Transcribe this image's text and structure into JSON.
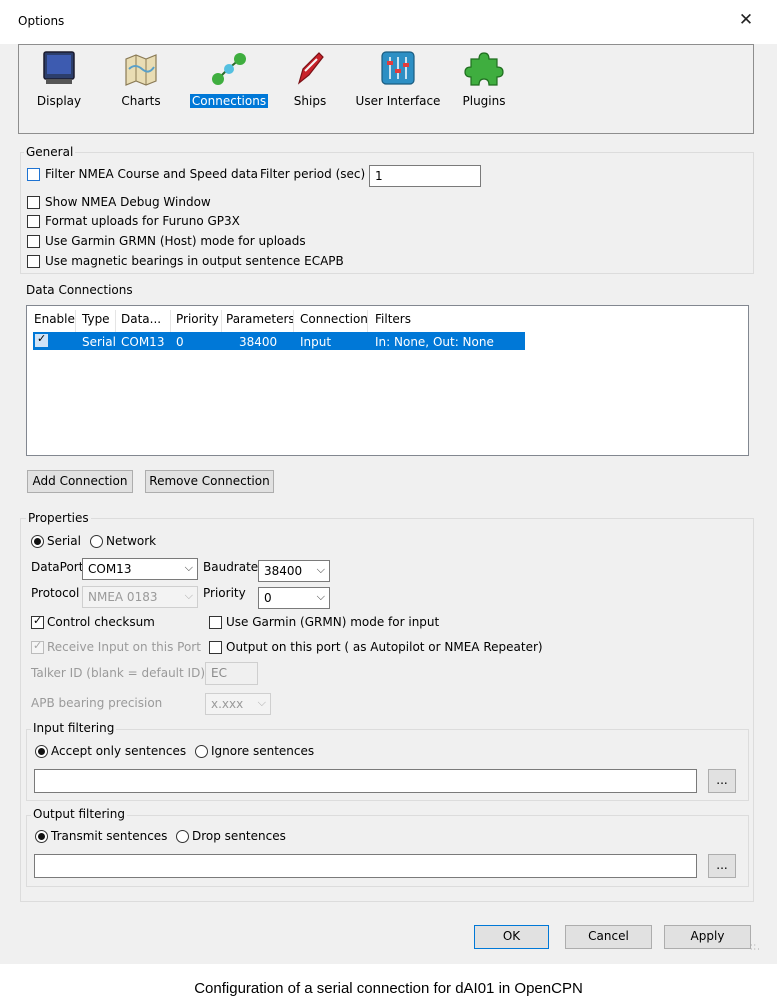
{
  "window": {
    "title": "Options"
  },
  "toolbar": {
    "items": [
      {
        "label": "Display",
        "icon": "monitor-icon"
      },
      {
        "label": "Charts",
        "icon": "chart-map-icon"
      },
      {
        "label": "Connections",
        "icon": "connections-icon",
        "selected": true
      },
      {
        "label": "Ships",
        "icon": "ship-icon"
      },
      {
        "label": "User Interface",
        "icon": "sliders-icon"
      },
      {
        "label": "Plugins",
        "icon": "puzzle-icon"
      }
    ]
  },
  "general": {
    "title": "General",
    "filter_nmea": "Filter NMEA Course and Speed data",
    "filter_period_label": "Filter period (sec)",
    "filter_period_value": "1",
    "show_debug": "Show NMEA Debug Window",
    "furuno": "Format uploads for Furuno GP3X",
    "garmin_host": "Use Garmin GRMN (Host) mode for uploads",
    "magnetic": "Use magnetic bearings in output sentence ECAPB"
  },
  "data_connections": {
    "title": "Data Connections",
    "columns": [
      "Enable",
      "Type",
      "Data...",
      "Priority",
      "Parameters",
      "Connection",
      "Filters"
    ],
    "rows": [
      {
        "enabled": true,
        "type": "Serial",
        "data": "COM13",
        "priority": "0",
        "parameters": "38400",
        "connection": "Input",
        "filters": "In: None, Out: None"
      }
    ],
    "add_button": "Add Connection",
    "remove_button": "Remove Connection"
  },
  "properties": {
    "title": "Properties",
    "serial": "Serial",
    "network": "Network",
    "dataport_label": "DataPort",
    "dataport_value": "COM13",
    "baudrate_label": "Baudrate",
    "baudrate_value": "38400",
    "protocol_label": "Protocol",
    "protocol_value": "NMEA 0183",
    "priority_label": "Priority",
    "priority_value": "0",
    "control_checksum": "Control checksum",
    "garmin_input": "Use Garmin (GRMN) mode for input",
    "receive_input": "Receive Input on this Port",
    "output_port": "Output on this port ( as Autopilot or NMEA Repeater)",
    "talker_label": "Talker ID (blank = default ID)",
    "talker_value": "EC",
    "apb_label": "APB bearing precision",
    "apb_value": "x.xxx"
  },
  "input_filtering": {
    "title": "Input filtering",
    "accept": "Accept only sentences",
    "ignore": "Ignore sentences",
    "value": "",
    "browse": "..."
  },
  "output_filtering": {
    "title": "Output filtering",
    "transmit": "Transmit sentences",
    "drop": "Drop sentences",
    "value": "",
    "browse": "..."
  },
  "footer": {
    "ok": "OK",
    "cancel": "Cancel",
    "apply": "Apply"
  },
  "caption": "Configuration of a serial connection for dAI01 in OpenCPN"
}
